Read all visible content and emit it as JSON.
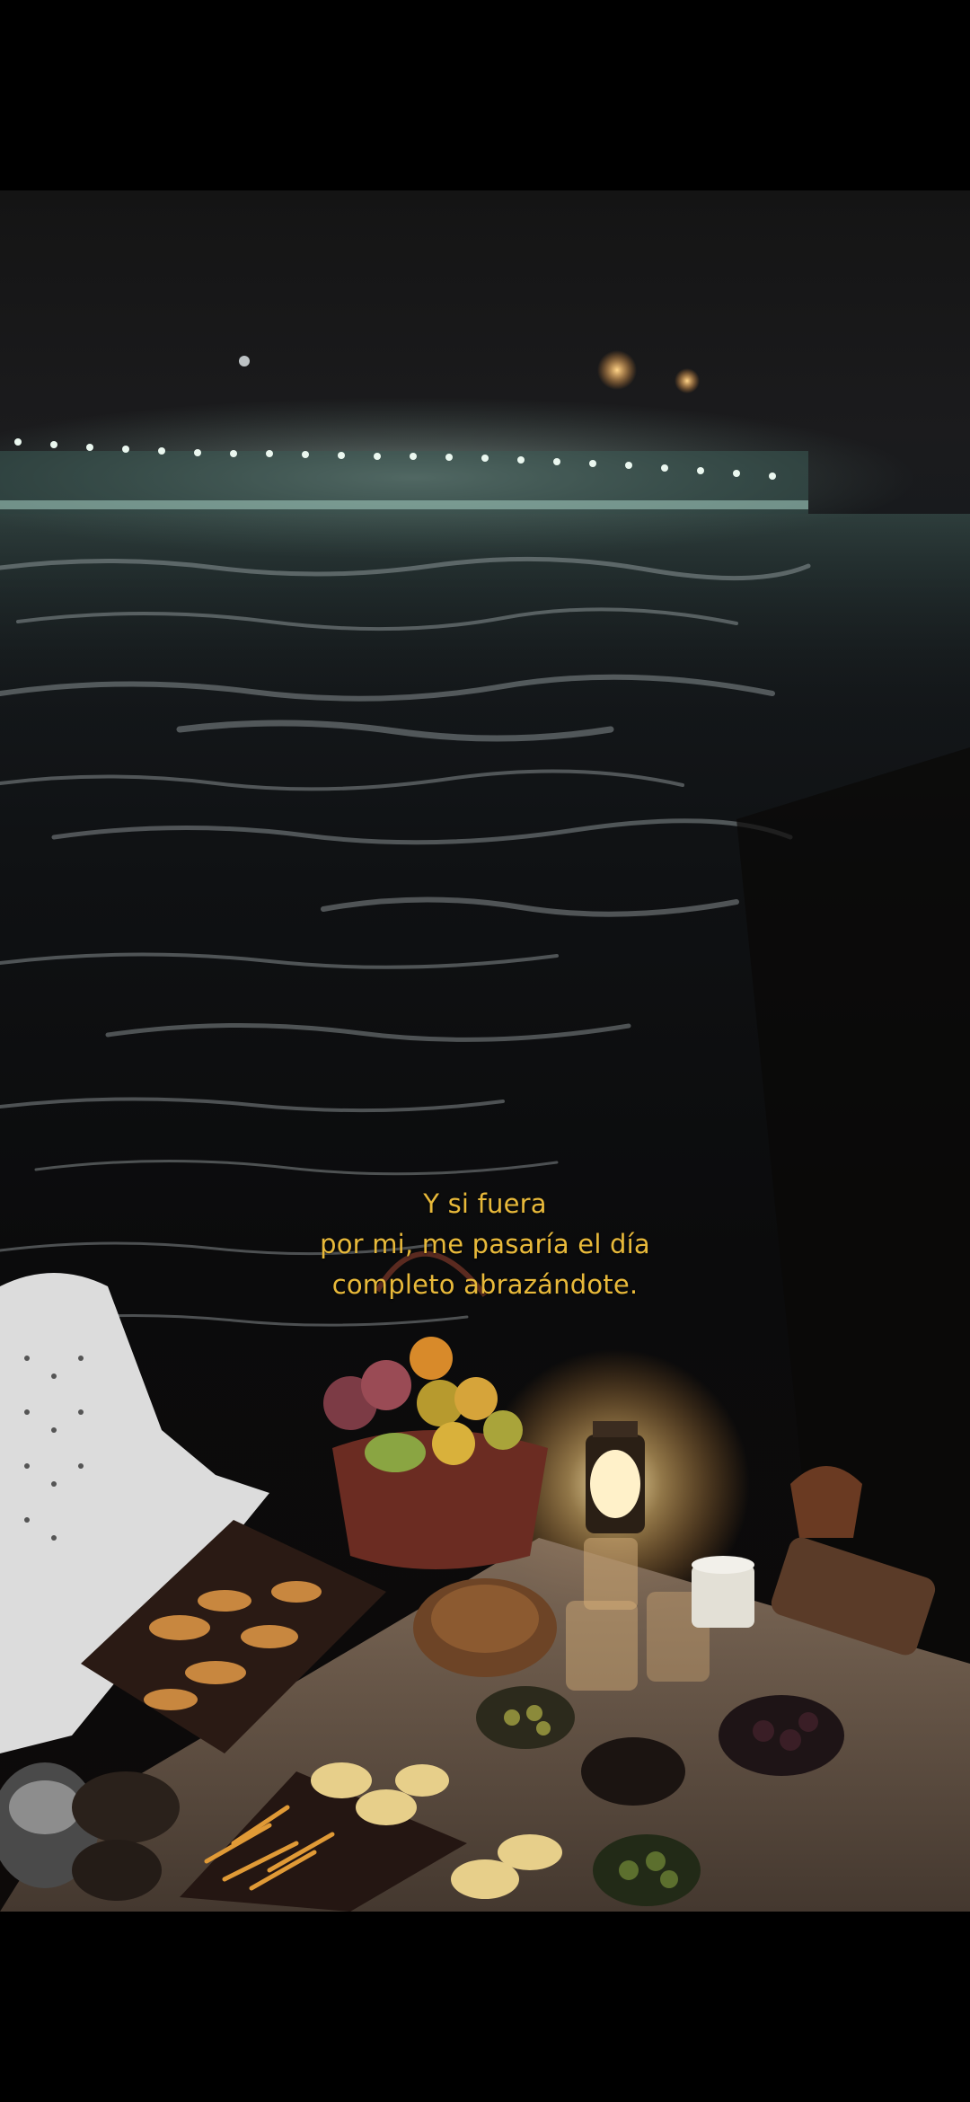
{
  "caption": {
    "line1": "Y si fuera",
    "line2": "por mi, me pasaría el día",
    "line3": "completo abrazándote.",
    "color": "#e8b93a"
  },
  "scene": {
    "subject": "night-picnic-by-water"
  },
  "colors": {
    "letterbox": "#000000",
    "water": "#0e0f11",
    "pier_lights": "#dfeee6",
    "lantern_glow": "#ffd98a"
  }
}
